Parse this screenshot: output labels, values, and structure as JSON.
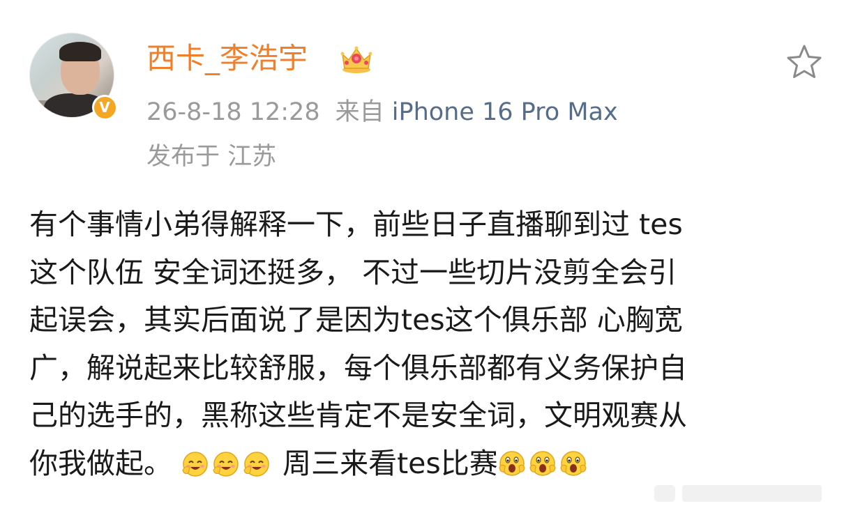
{
  "user": {
    "name": "西卡_李浩宇",
    "verified_badge": "V",
    "crown_icon": "crown-icon"
  },
  "meta": {
    "time": "26-8-18 12:28",
    "source_prefix": "来自",
    "device": "iPhone 16 Pro Max",
    "location": "发布于 江苏"
  },
  "actions": {
    "favorite_icon": "star-icon"
  },
  "post": {
    "lines": [
      "有个事情小弟得解释一下，前些日子直播聊到过 tes",
      "这个队伍 安全词还挺多，  不过一些切片没剪全会引",
      "起误会，其实后面说了是因为tes这个俱乐部 心胸宽",
      "广，解说起来比较舒服，每个俱乐部都有义务保护自",
      "己的选手的，黑称这些肯定不是安全词，文明观赛从"
    ],
    "last_line_start": "你我做起。",
    "last_line_mid": " 周三来看tes比赛"
  },
  "colors": {
    "username": "#f07f2c",
    "meta": "#9a9a9a",
    "device": "#556c8a",
    "text": "#1a1a1a",
    "badge": "#f5a623"
  }
}
